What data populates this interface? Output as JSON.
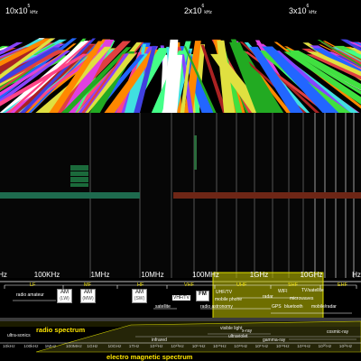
{
  "top_axis": {
    "labels": [
      {
        "mantissa": "10x10",
        "exp": "5",
        "unit": "kHz"
      },
      {
        "mantissa": "2x10",
        "exp": "6",
        "unit": "kHz"
      },
      {
        "mantissa": "3x10",
        "exp": "6",
        "unit": "kHz"
      }
    ]
  },
  "scale": {
    "labels": [
      "Hz",
      "100KHz",
      "1MHz",
      "10MHz",
      "100MHz",
      "1GHz",
      "10GHz",
      "Hz"
    ]
  },
  "bands": [
    "LF",
    "MF",
    "HF",
    "VHF",
    "UHF",
    "SHF",
    "EHF"
  ],
  "services": {
    "radio_amateur": "radio amateur",
    "am_lw": "AM",
    "am_lw_sub": "(LW)",
    "am_mw": "AM",
    "am_mw_sub": "(MW)",
    "am_sw": "AM",
    "am_sw_sub": "(SW)",
    "vhf_tv": "VHF/TV",
    "fm": "FM",
    "uhf_tv": "UHF/TV",
    "mobile_phone": "mobile phone",
    "satellite": "satellite",
    "radio_astronomy": "radio astronomy",
    "radar": "radar",
    "wifi": "WIFI",
    "tv_satellite": "TV/satellite",
    "microwaves": "microwaves",
    "gps": "GPS",
    "bluetooth": "bluetooth",
    "mobile_radar": "mobile/radar"
  },
  "titles": {
    "radio_spectrum": "radio spectrum",
    "em_spectrum": "electro magnetic spectrum"
  },
  "em_scale": {
    "ticks": [
      "10kHz",
      "100kHz",
      "1MHz",
      "100MHz",
      "1GHz",
      "10GHz",
      "1THz",
      "10¹²Hz",
      "10¹³Hz",
      "10¹⁴Hz",
      "10¹⁵Hz",
      "10¹⁶Hz",
      "10¹⁷Hz",
      "10¹⁸Hz",
      "10¹⁹Hz",
      "10²⁰Hz",
      "10²¹Hz"
    ],
    "waves": {
      "ultra_sonics": "ultra-sonics",
      "visible_light": "visible light",
      "xray": "x-ray",
      "infrared": "infrared",
      "ultraviolet": "ultraviolet",
      "gamma": "gamma-ray",
      "cosmic": "cosmic-ray"
    }
  },
  "colors": {
    "background": "#000000",
    "band_yellow": "#f0e000",
    "highlight": "#c8c800",
    "bar_green": "#1a7a50",
    "bar_red": "#7a2a18"
  }
}
